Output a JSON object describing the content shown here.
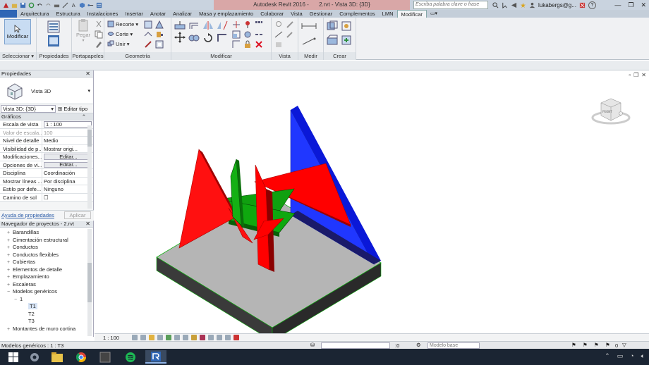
{
  "title_bar": {
    "app": "Autodesk Revit 2016 -",
    "document": "2.rvt - Vista 3D: {3D}",
    "search_placeholder": "Escriba palabra clave o frase",
    "user": "lukabergs@g...",
    "help": "?"
  },
  "tabs": [
    "Arquitectura",
    "Estructura",
    "Instalaciones",
    "Insertar",
    "Anotar",
    "Analizar",
    "Masa y emplazamiento",
    "Colaborar",
    "Vista",
    "Gestionar",
    "Complementos",
    "LMN",
    "Modificar"
  ],
  "active_tab": "Modificar",
  "ribbon": {
    "modificar_btn": "Modificar",
    "pegar": "Pegar",
    "recorte": "Recorte",
    "corte": "Corte",
    "unir": "Unir",
    "panels": {
      "seleccionar": "Seleccionar",
      "propiedades": "Propiedades",
      "portapapeles": "Portapapeles",
      "geometria": "Geometría",
      "modificar": "Modificar",
      "vista": "Vista",
      "medir": "Medir",
      "crear": "Crear"
    }
  },
  "properties": {
    "title": "Propiedades",
    "type_name": "Vista 3D",
    "view_selector": "Vista 3D: {3D}",
    "edit_type": "Editar tipo",
    "group": "Gráficos",
    "rows": [
      {
        "key": "Escala de vista",
        "value": "1 : 100",
        "kind": "box"
      },
      {
        "key": "Valor de escala...",
        "value": "100",
        "kind": "dim"
      },
      {
        "key": "Nivel de detalle",
        "value": "Medio",
        "kind": "text"
      },
      {
        "key": "Visibilidad de p...",
        "value": "Mostrar origi...",
        "kind": "text"
      },
      {
        "key": "Modificaciones...",
        "value": "Editar...",
        "kind": "btn"
      },
      {
        "key": "Opciones de vi...",
        "value": "Editar...",
        "kind": "btn"
      },
      {
        "key": "Disciplina",
        "value": "Coordinación",
        "kind": "text"
      },
      {
        "key": "Mostrar líneas ...",
        "value": "Por disciplina",
        "kind": "text"
      },
      {
        "key": "Estilo por defe...",
        "value": "Ninguno",
        "kind": "text"
      },
      {
        "key": "Camino de sol",
        "value": "☐",
        "kind": "text"
      }
    ],
    "help_link": "Ayuda de propiedades",
    "apply": "Aplicar"
  },
  "browser": {
    "title": "Navegador de proyectos - 2.rvt",
    "items": [
      {
        "label": "Barandillas",
        "level": 1,
        "pm": "+"
      },
      {
        "label": "Cimentación estructural",
        "level": 1,
        "pm": "+"
      },
      {
        "label": "Conductos",
        "level": 1,
        "pm": "+"
      },
      {
        "label": "Conductos flexibles",
        "level": 1,
        "pm": "+"
      },
      {
        "label": "Cubiertas",
        "level": 1,
        "pm": "+"
      },
      {
        "label": "Elementos de detalle",
        "level": 1,
        "pm": "+"
      },
      {
        "label": "Emplazamiento",
        "level": 1,
        "pm": "+"
      },
      {
        "label": "Escaleras",
        "level": 1,
        "pm": "+"
      },
      {
        "label": "Modelos genéricos",
        "level": 1,
        "pm": "−"
      },
      {
        "label": "1",
        "level": 2,
        "pm": "−"
      },
      {
        "label": "T1",
        "level": 3,
        "pm": ""
      },
      {
        "label": "T2",
        "level": 3,
        "pm": ""
      },
      {
        "label": "T3",
        "level": 3,
        "pm": ""
      },
      {
        "label": "Montantes de muro cortina",
        "level": 1,
        "pm": "+"
      }
    ]
  },
  "view_bar": {
    "scale": "1 : 100"
  },
  "status_bar": {
    "selection": "Modelos genéricos : 1 : T3",
    "selection_count": ":0",
    "model_placeholder": "Modelo base",
    "filter_count": "0"
  },
  "viewcube": {
    "label": "FRONT"
  },
  "colors": {
    "red": "#ff0000",
    "green": "#10b010",
    "blue": "#1a2fff",
    "base_top": "#b5b5b5",
    "base_side": "#2f2f2f",
    "taskbar": "#1b2533"
  }
}
